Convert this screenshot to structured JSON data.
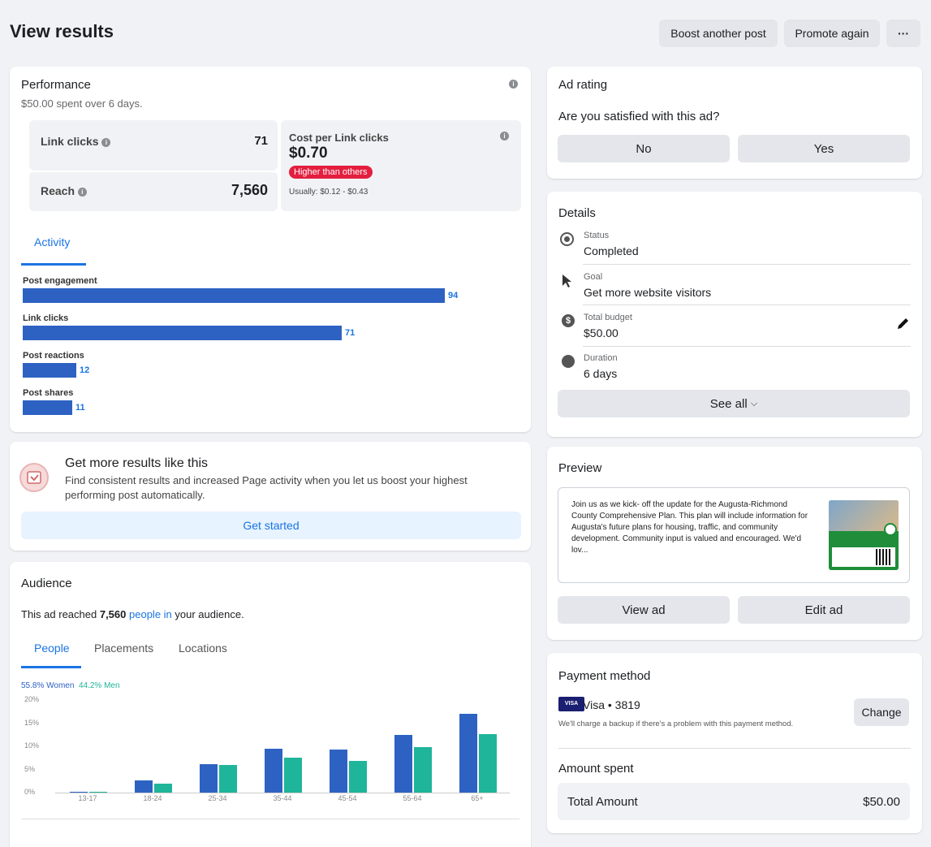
{
  "page": {
    "title": "View results",
    "boost_another": "Boost another post",
    "promote_again": "Promote again",
    "more": "···"
  },
  "performance": {
    "title": "Performance",
    "subtitle": "$50.00 spent over 6 days.",
    "link_clicks_label": "Link clicks",
    "link_clicks_value": "71",
    "reach_label": "Reach",
    "reach_value": "7,560",
    "cpc_label": "Cost per Link clicks",
    "cpc_value": "$0.70",
    "cpc_badge": "Higher than others",
    "cpc_usual": "Usually: $0.12 - $0.43",
    "tab_activity": "Activity",
    "activity": [
      {
        "label": "Post engagement",
        "value": 94
      },
      {
        "label": "Link clicks",
        "value": 71
      },
      {
        "label": "Post reactions",
        "value": 12
      },
      {
        "label": "Post shares",
        "value": 11
      }
    ]
  },
  "more_results": {
    "title": "Get more results like this",
    "description": "Find consistent results and increased Page activity when you let us boost your highest performing post automatically.",
    "button": "Get started"
  },
  "audience": {
    "title": "Audience",
    "reach_prefix": "This ad reached ",
    "reach_count": "7,560",
    "reach_link": "people in",
    "reach_suffix": " your audience.",
    "tabs": [
      "People",
      "Placements",
      "Locations"
    ],
    "legend_women": "55.8% Women",
    "legend_men": "44.2% Men",
    "colors": {
      "women": "#2d62c3",
      "men": "#1fb59a"
    }
  },
  "chart_data": {
    "type": "bar",
    "categories": [
      "13-17",
      "18-24",
      "25-34",
      "35-44",
      "45-54",
      "55-64",
      "65+"
    ],
    "series": [
      {
        "name": "Women",
        "values": [
          0.1,
          2.7,
          6.2,
          9.5,
          9.3,
          12.5,
          17.0
        ]
      },
      {
        "name": "Men",
        "values": [
          0.1,
          1.9,
          6.0,
          7.6,
          6.9,
          9.9,
          12.6
        ]
      }
    ],
    "ylim": [
      0,
      20
    ],
    "yticks": [
      "20%",
      "15%",
      "10%",
      "5%",
      "0%"
    ]
  },
  "ad_rating": {
    "title": "Ad rating",
    "question": "Are you satisfied with this ad?",
    "no": "No",
    "yes": "Yes"
  },
  "details": {
    "title": "Details",
    "rows": [
      {
        "small": "Status",
        "main": "Completed"
      },
      {
        "small": "Goal",
        "main": "Get more website visitors"
      },
      {
        "small": "Total budget",
        "main": "$50.00"
      },
      {
        "small": "Duration",
        "main": "6 days"
      }
    ],
    "see_all": "See all"
  },
  "preview": {
    "title": "Preview",
    "text": "Join us as we kick- off the update for the Augusta-Richmond County Comprehensive Plan. This plan will include information for Augusta's future plans for housing, traffic, and community development. Community input is valued and encouraged. We'd lov...",
    "view_ad": "View ad",
    "edit_ad": "Edit ad"
  },
  "payment": {
    "title": "Payment method",
    "card_brand": "VISA",
    "card_text": "Visa • 3819",
    "note": "We'll charge a backup if there's a problem with this payment method.",
    "change": "Change",
    "amount_title": "Amount spent",
    "total_label": "Total Amount",
    "total_value": "$50.00"
  }
}
